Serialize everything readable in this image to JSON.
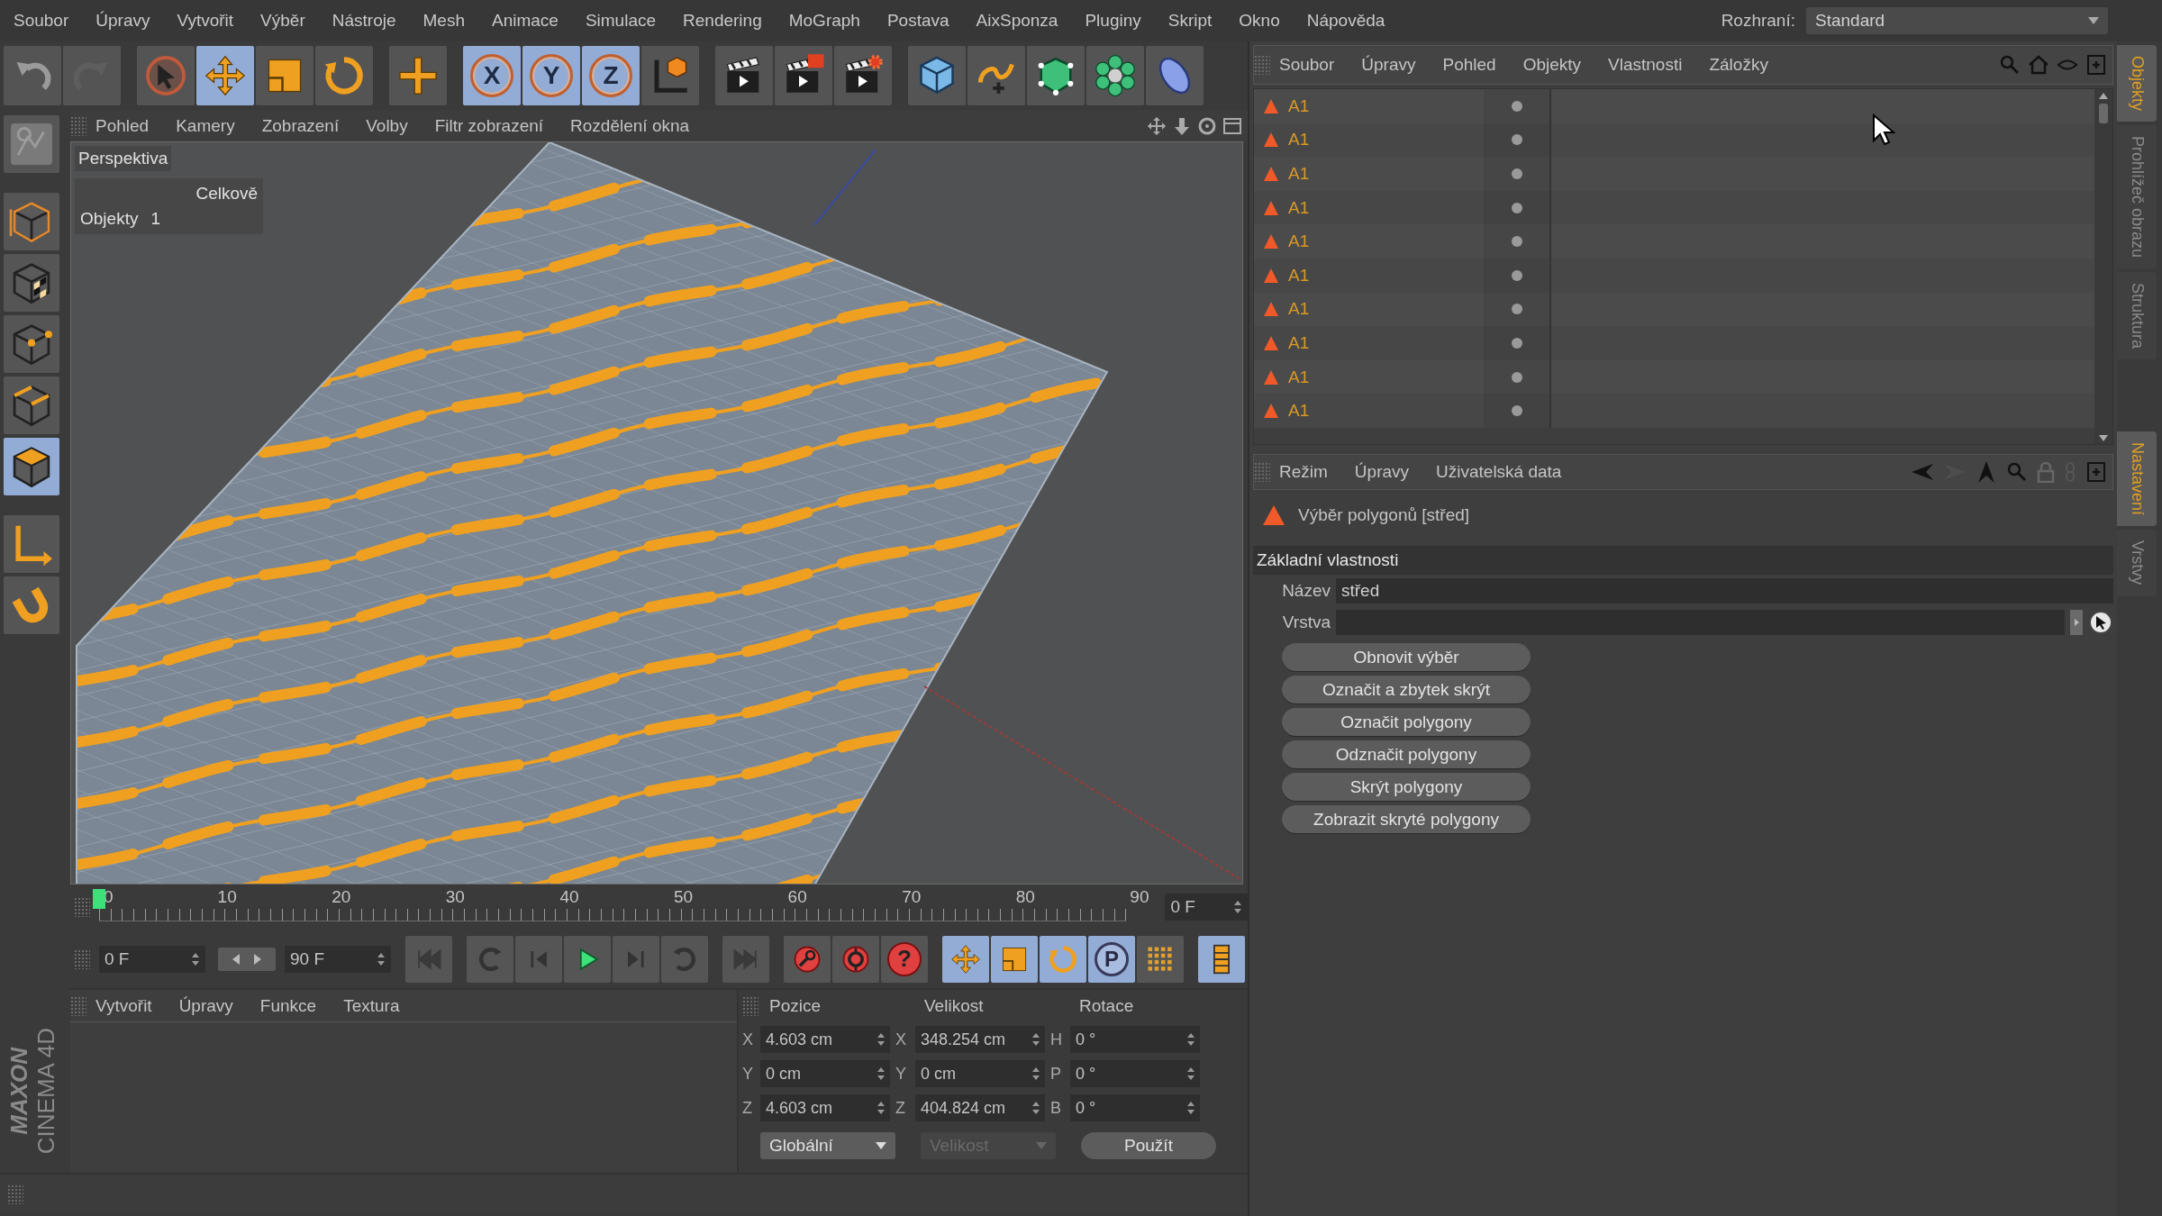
{
  "menu_bar": {
    "items": [
      "Soubor",
      "Úpravy",
      "Vytvořit",
      "Výběr",
      "Nástroje",
      "Mesh",
      "Animace",
      "Simulace",
      "Rendering",
      "MoGraph",
      "Postava",
      "AixSponza",
      "Pluginy",
      "Skript",
      "Okno",
      "Nápověda"
    ],
    "layout_label": "Rozhraní:",
    "layout_value": "Standard"
  },
  "toolbar": [
    {
      "tools": [
        {
          "kind": "undo",
          "selected": false
        },
        {
          "kind": "redo",
          "selected": false
        }
      ]
    },
    {
      "tools": [
        {
          "kind": "select",
          "selected": false
        },
        {
          "kind": "move",
          "selected": true
        },
        {
          "kind": "scale",
          "selected": false
        },
        {
          "kind": "rotate",
          "selected": false
        }
      ]
    },
    {
      "tools": [
        {
          "kind": "add",
          "selected": false
        }
      ]
    },
    {
      "tools": [
        {
          "kind": "axis",
          "label": "X",
          "selected": true
        },
        {
          "kind": "axis",
          "label": "Y",
          "selected": true
        },
        {
          "kind": "axis",
          "label": "Z",
          "selected": true
        },
        {
          "kind": "coord",
          "selected": false
        }
      ]
    },
    {
      "tools": [
        {
          "kind": "render",
          "selected": false
        },
        {
          "kind": "render-viewer",
          "selected": false
        },
        {
          "kind": "render-settings",
          "selected": false
        }
      ]
    },
    {
      "tools": [
        {
          "kind": "cube",
          "selected": false
        },
        {
          "kind": "spline",
          "selected": false
        },
        {
          "kind": "nurbs",
          "selected": false
        },
        {
          "kind": "array",
          "selected": false
        },
        {
          "kind": "deformer",
          "selected": false
        }
      ]
    }
  ],
  "tool_palette": [
    {
      "kind": "sketch",
      "selected": false
    },
    {
      "kind": "object",
      "selected": false
    },
    {
      "kind": "texture",
      "selected": false
    },
    {
      "kind": "points",
      "selected": false
    },
    {
      "kind": "edges",
      "selected": false
    },
    {
      "kind": "polygons",
      "selected": true
    },
    {
      "kind": "axis",
      "selected": false
    },
    {
      "kind": "snap",
      "selected": false
    }
  ],
  "logo": {
    "brand": "MAXON",
    "product": "CINEMA 4D"
  },
  "viewport": {
    "menu": [
      "Pohled",
      "Kamery",
      "Zobrazení",
      "Volby",
      "Filtr zobrazení",
      "Rozdělení okna"
    ],
    "view_name": "Perspektiva",
    "stats_header": "Celkově",
    "stats": [
      {
        "label": "Objekty",
        "value": "1"
      }
    ]
  },
  "timeline": {
    "ticks": [
      "0",
      "10",
      "20",
      "30",
      "40",
      "50",
      "60",
      "70",
      "80",
      "90"
    ],
    "playhead": {
      "level": 0
    },
    "current_frame": "0 F"
  },
  "playback": {
    "start": "0 F",
    "end": "90 F",
    "buttons": [
      {
        "kind": "go-start",
        "selected": false
      },
      {
        "kind": "prev-key",
        "selected": false
      },
      {
        "kind": "prev-frame",
        "selected": false
      },
      {
        "kind": "play",
        "selected": false
      },
      {
        "kind": "next-frame",
        "selected": false
      },
      {
        "kind": "next-key",
        "selected": false
      },
      {
        "kind": "go-end",
        "selected": false
      },
      {
        "kind": "record",
        "selected": false
      },
      {
        "kind": "autokey",
        "selected": false
      },
      {
        "kind": "help",
        "label": "?",
        "selected": false
      },
      {
        "kind": "move",
        "selected": true
      },
      {
        "kind": "scale",
        "selected": true
      },
      {
        "kind": "rotate",
        "selected": true
      },
      {
        "kind": "param",
        "label": "P",
        "selected": true
      },
      {
        "kind": "dots",
        "selected": false
      },
      {
        "kind": "film",
        "selected": true
      }
    ]
  },
  "material_manager": {
    "menu": [
      "Vytvořit",
      "Úpravy",
      "Funkce",
      "Textura"
    ]
  },
  "coordinates": {
    "headers": [
      "Pozice",
      "Velikost",
      "Rotace"
    ],
    "rows": [
      {
        "position_axis": "X",
        "position": "4.603 cm",
        "size_axis": "X",
        "size": "348.254 cm",
        "rotation_axis": "H",
        "rotation": "0 °"
      },
      {
        "position_axis": "Y",
        "position": "0 cm",
        "size_axis": "Y",
        "size": "0 cm",
        "rotation_axis": "P",
        "rotation": "0 °"
      },
      {
        "position_axis": "Z",
        "position": "4.603 cm",
        "size_axis": "Z",
        "size": "404.824 cm",
        "rotation_axis": "B",
        "rotation": "0 °"
      }
    ],
    "dropdowns": [
      {
        "label": "Globální",
        "disabled": false
      },
      {
        "label": "Velikost",
        "disabled": true
      }
    ],
    "apply": "Použít"
  },
  "object_manager": {
    "menu": [
      "Soubor",
      "Úpravy",
      "Pohled",
      "Objekty",
      "Vlastnosti",
      "Záložky"
    ],
    "objects": [
      {
        "name": "A1"
      },
      {
        "name": "A1"
      },
      {
        "name": "A1"
      },
      {
        "name": "A1"
      },
      {
        "name": "A1"
      },
      {
        "name": "A1"
      },
      {
        "name": "A1"
      },
      {
        "name": "A1"
      },
      {
        "name": "A1"
      },
      {
        "name": "A1"
      }
    ]
  },
  "attribute_manager": {
    "menu": [
      "Režim",
      "Úpravy",
      "Uživatelská data"
    ],
    "title": "Výběr polygonů [střed]",
    "section": "Základní vlastnosti",
    "fields": [
      {
        "label": "Název",
        "kind": "text",
        "value": "střed"
      },
      {
        "label": "Vrstva",
        "kind": "link"
      }
    ],
    "buttons": [
      "Obnovit výběr",
      "Označit a zbytek skrýt",
      "Označit polygony",
      "Odznačit polygony",
      "Skrýt polygony",
      "Zobrazit skryté polygony"
    ]
  },
  "side_tabs_top": [
    {
      "label": "Objekty",
      "selected": true
    },
    {
      "label": "Prohlížeč obrazu",
      "selected": false
    },
    {
      "label": "Struktura",
      "selected": false
    }
  ],
  "side_tabs_bottom": [
    {
      "label": "Nastavení",
      "selected": true
    },
    {
      "label": "Vrstvy",
      "selected": false
    }
  ]
}
